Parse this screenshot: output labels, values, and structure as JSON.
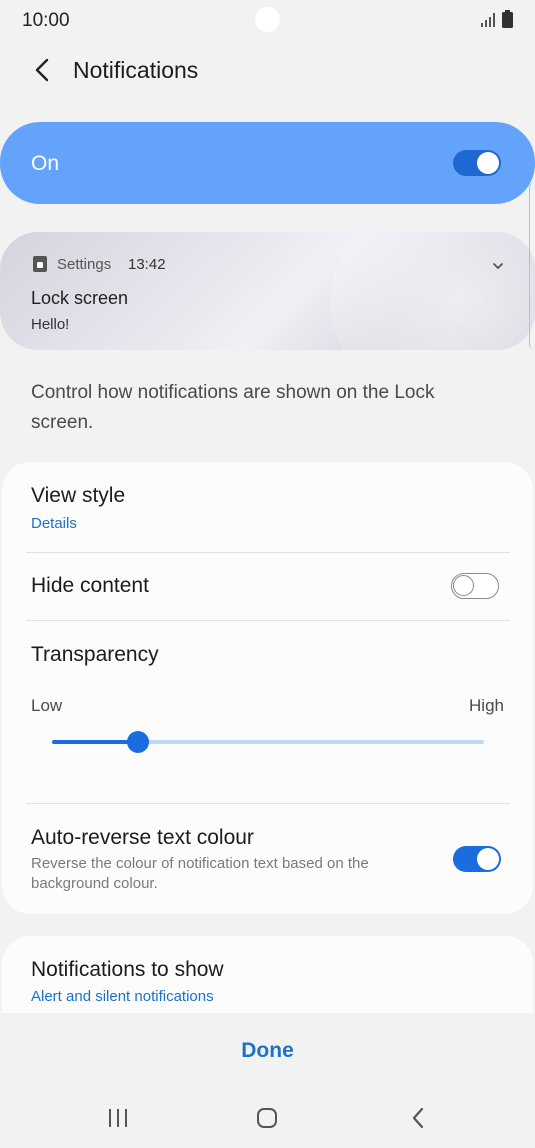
{
  "status_bar": {
    "time": "10:00",
    "signal_icon": "signal-icon",
    "battery_icon": "battery-icon"
  },
  "header": {
    "title": "Notifications",
    "back_icon": "chevron-left-icon"
  },
  "master": {
    "label": "On",
    "enabled": true
  },
  "preview": {
    "app_name": "Settings",
    "time": "13:42",
    "title": "Lock screen",
    "body": "Hello!",
    "app_icon": "lock-icon",
    "expand_icon": "chevron-down-icon"
  },
  "description": "Control how notifications are shown on the Lock screen.",
  "settings": {
    "view_style": {
      "title": "View style",
      "value": "Details"
    },
    "hide_content": {
      "title": "Hide content",
      "enabled": false
    },
    "transparency": {
      "title": "Transparency",
      "low_label": "Low",
      "high_label": "High",
      "level": 0.2
    },
    "auto_reverse": {
      "title": "Auto-reverse text colour",
      "description": "Reverse the colour of notification text based on the background colour.",
      "enabled": true
    }
  },
  "notifications_to_show": {
    "title": "Notifications to show",
    "value": "Alert and silent notifications"
  },
  "footer": {
    "done_label": "Done"
  },
  "nav": {
    "recents_icon": "recents-icon",
    "home_icon": "home-icon",
    "back_icon": "back-icon"
  },
  "colors": {
    "accent": "#1b6ce0",
    "master_bg": "#64a3fb",
    "link": "#1a73c9"
  }
}
